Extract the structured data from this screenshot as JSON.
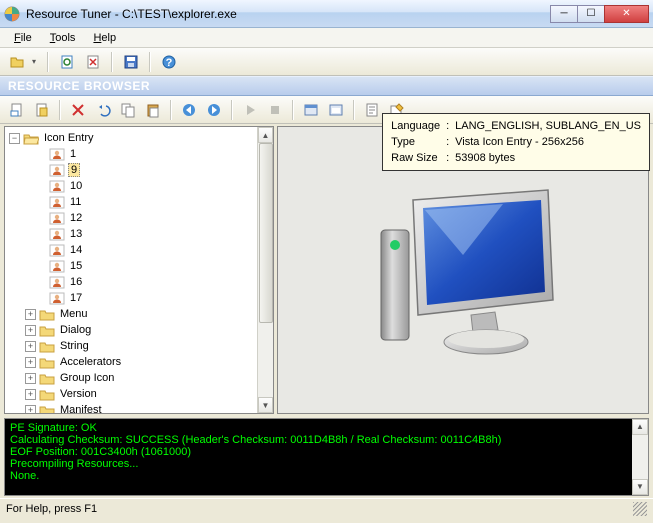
{
  "title": "Resource Tuner - C:\\TEST\\explorer.exe",
  "menu": {
    "file": "File",
    "tools": "Tools",
    "help": "Help"
  },
  "section_header": "RESOURCE BROWSER",
  "tree": {
    "root": "Icon Entry",
    "icons": [
      "1",
      "9",
      "10",
      "11",
      "12",
      "13",
      "14",
      "15",
      "16",
      "17"
    ],
    "selected": "9",
    "folders": [
      "Menu",
      "Dialog",
      "String",
      "Accelerators",
      "Group Icon",
      "Version",
      "Manifest"
    ]
  },
  "info": {
    "lang_label": "Language",
    "lang_value": "LANG_ENGLISH, SUBLANG_EN_US",
    "type_label": "Type",
    "type_value": "Vista Icon Entry - 256x256",
    "size_label": "Raw Size",
    "size_value": "53908 bytes"
  },
  "console": {
    "l1": "PE Signature: OK",
    "l2": "Calculating Checksum: SUCCESS (Header's Checksum: 0011D4B8h / Real Checksum: 0011C4B8h)",
    "l3": "EOF Position: 001C3400h  (1061000)",
    "l4": "Precompiling Resources...",
    "l5": "None."
  },
  "status": "For Help, press F1"
}
